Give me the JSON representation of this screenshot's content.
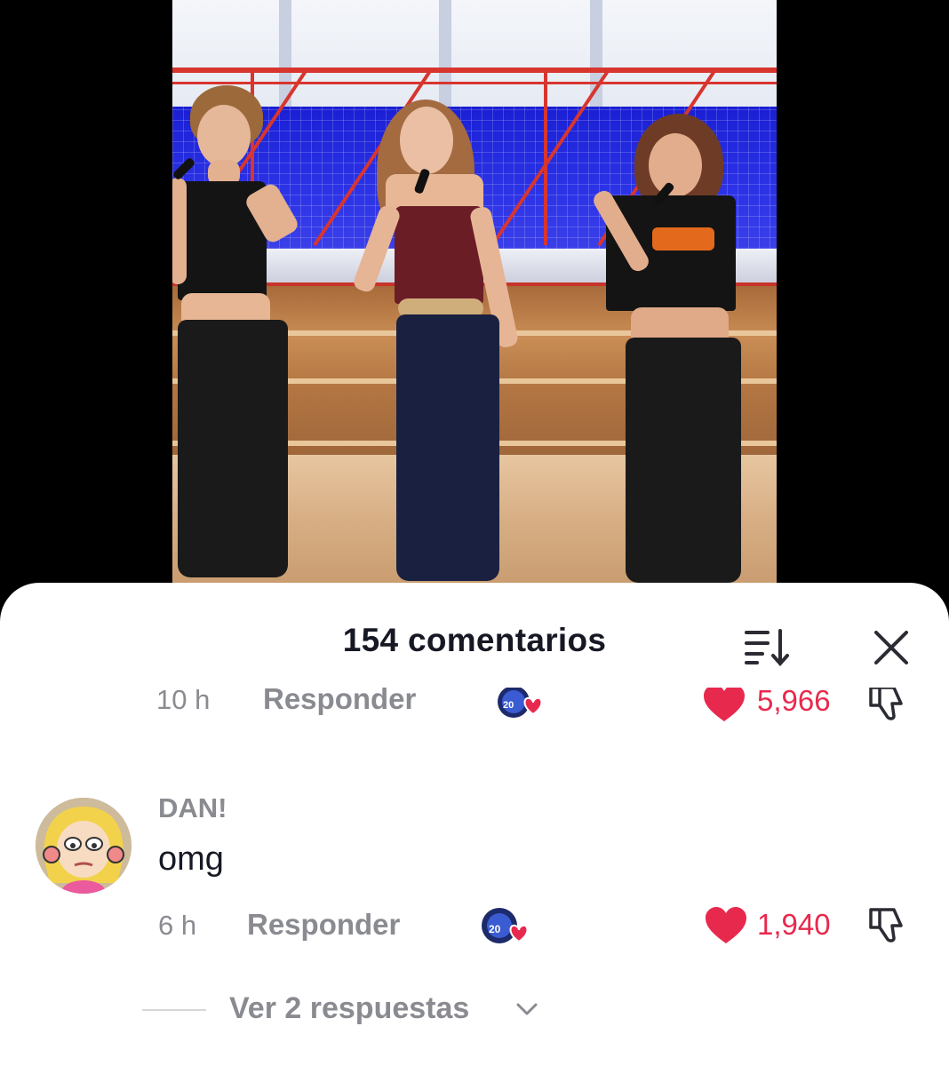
{
  "video": {
    "alt": "video"
  },
  "comments_sheet": {
    "title": "154 comentarios",
    "sort_icon": "sort-descending-icon",
    "close_icon": "close-icon"
  },
  "comments": [
    {
      "time": "10 h",
      "reply_label": "Responder",
      "likes": "5,966",
      "liked": true,
      "creator_badge": "creator-liked-badge"
    },
    {
      "username": "DAN!",
      "text": "omg",
      "time": "6 h",
      "reply_label": "Responder",
      "likes": "1,940",
      "liked": true,
      "creator_badge": "creator-liked-badge",
      "view_replies": "Ver 2 respuestas"
    }
  ],
  "colors": {
    "like_red": "#e8294e",
    "meta_gray": "#8a8b91",
    "title_dark": "#161823"
  }
}
